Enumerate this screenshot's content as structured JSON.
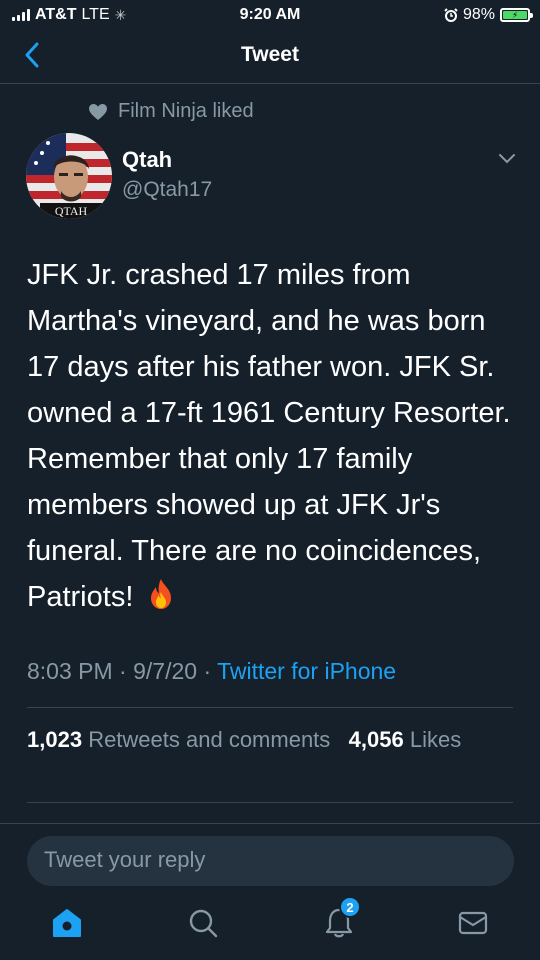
{
  "status_bar": {
    "carrier": "AT&T",
    "network": "LTE",
    "time": "9:20 AM",
    "battery": "98%"
  },
  "nav": {
    "title": "Tweet",
    "back_icon": "chevron-left-icon"
  },
  "social_context": {
    "icon": "heart-icon",
    "text": "Film Ninja liked"
  },
  "author": {
    "name": "Qtah",
    "handle": "@Qtah17",
    "avatar_text": "QTAH"
  },
  "tweet": {
    "text": "JFK Jr. crashed 17 miles from Martha's vineyard, and he was born 17 days after his father won. JFK Sr. owned a 17-ft 1961 Century Resorter. Remember that only 17 family members showed up at JFK Jr's funeral. There are no coincidences, Patriots!",
    "emoji": "🔥",
    "time": "8:03 PM",
    "date": "9/7/20",
    "separator": "·",
    "source": "Twitter for iPhone"
  },
  "stats": {
    "retweets_count": "1,023",
    "retweets_label": "Retweets and comments",
    "likes_count": "4,056",
    "likes_label": "Likes"
  },
  "reply": {
    "placeholder": "Tweet your reply"
  },
  "tab_bar": {
    "items": [
      {
        "name": "home",
        "icon": "home-icon",
        "active": true
      },
      {
        "name": "search",
        "icon": "search-icon",
        "active": false
      },
      {
        "name": "notifications",
        "icon": "bell-icon",
        "active": false,
        "badge": "2"
      },
      {
        "name": "messages",
        "icon": "mail-icon",
        "active": false
      }
    ]
  },
  "colors": {
    "background": "#15202b",
    "accent": "#1da1f2",
    "secondary_text": "#8899a6",
    "divider": "#38444d"
  }
}
